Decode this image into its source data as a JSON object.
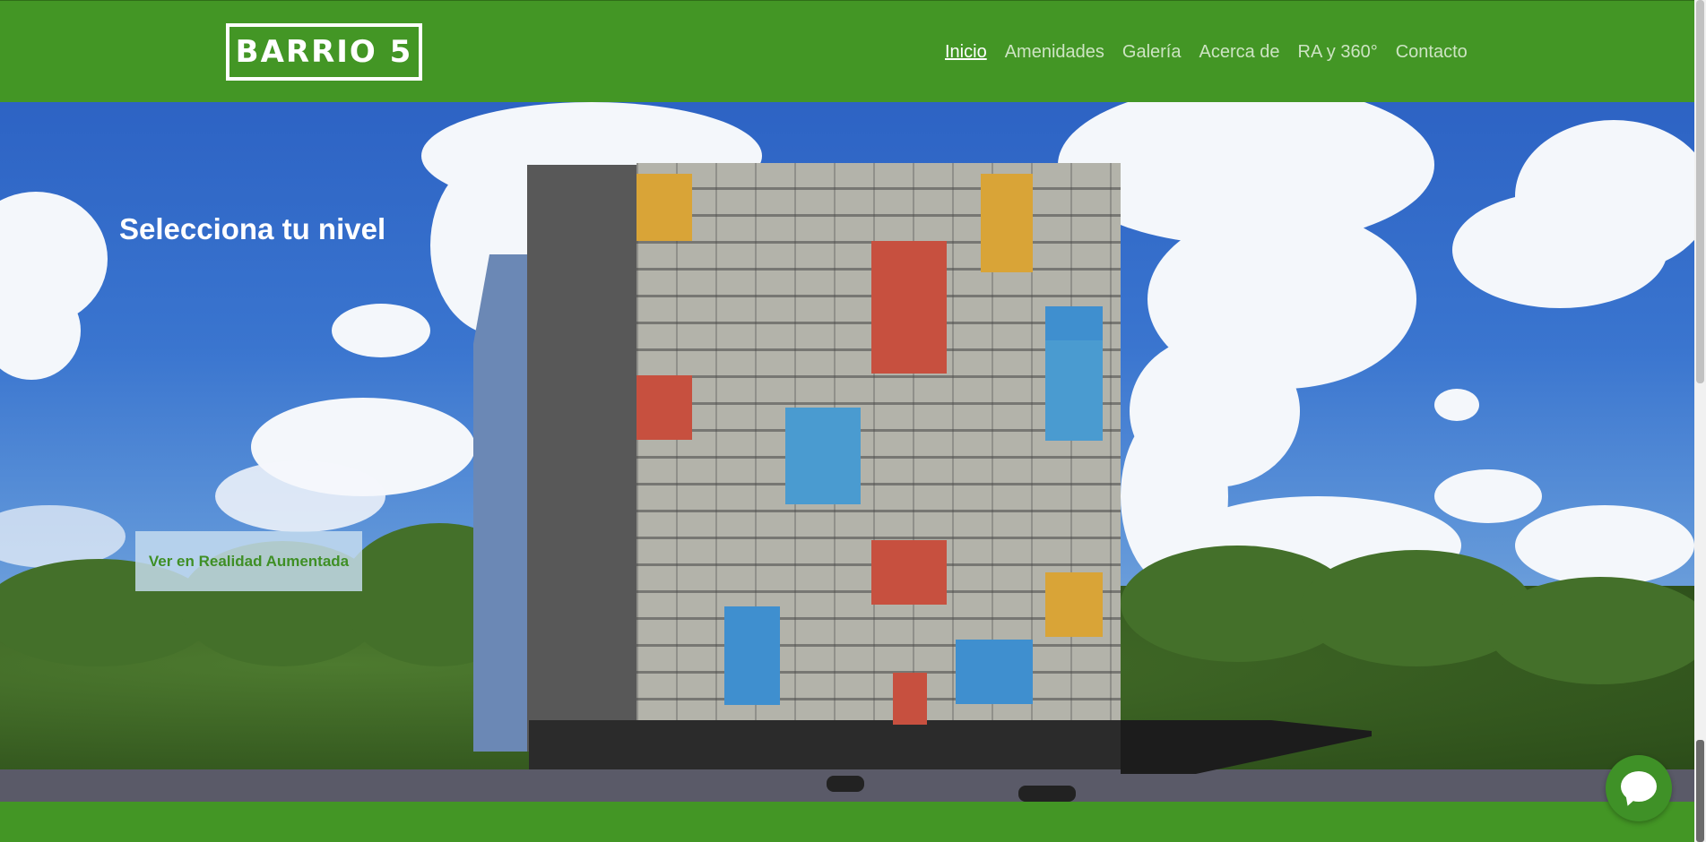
{
  "header": {
    "logo_text": "BARRIO 5",
    "nav": [
      {
        "label": "Inicio",
        "active": true
      },
      {
        "label": "Amenidades"
      },
      {
        "label": "Galería"
      },
      {
        "label": "Acerca de"
      },
      {
        "label": "RA y 360°"
      },
      {
        "label": "Contacto"
      }
    ]
  },
  "hero": {
    "title": "Selecciona tu nivel",
    "ar_button": "Ver en Realidad Aumentada"
  },
  "colors": {
    "brand_green": "#439625",
    "button_text": "#3f8f25"
  },
  "chat": {
    "icon": "chat-bubble-icon"
  }
}
